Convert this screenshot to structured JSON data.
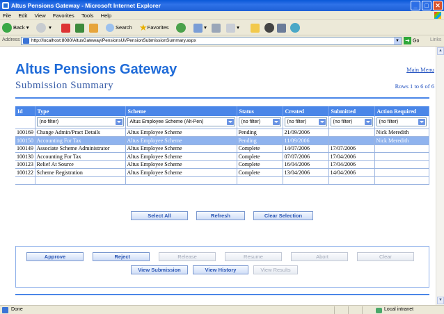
{
  "window": {
    "title": "Altus Pensions Gateway - Microsoft Internet Explorer"
  },
  "menu": [
    "File",
    "Edit",
    "View",
    "Favorites",
    "Tools",
    "Help"
  ],
  "toolbar": {
    "back": "Back",
    "search": "Search",
    "favorites": "Favorites"
  },
  "address": {
    "label": "Address",
    "url": "http://localhost:8080/AltusGateway/PensionsUI/PensionSubmissionSummary.aspx",
    "go": "Go",
    "links": "Links"
  },
  "page": {
    "title": "Altus Pensions Gateway",
    "subtitle": "Submission Summary",
    "main_menu": "Main Menu",
    "row_count": "Rows 1 to 6 of 6"
  },
  "table": {
    "headers": [
      "Id",
      "Type",
      "Scheme",
      "Status",
      "Created",
      "Submitted",
      "Action Required"
    ],
    "filters": [
      "(no filter)",
      "Altus Employee Scheme (Alt-Pen)",
      "(no filter)",
      "(no filter)",
      "(no filter)",
      "(no filter)"
    ],
    "rows": [
      [
        "100169",
        "Change Admin/Pract Details",
        "Altus Employee Scheme",
        "Pending",
        "21/09/2006",
        "",
        "Nick Meredith"
      ],
      [
        "100150",
        "Accounting For Tax",
        "Altus Employee Scheme",
        "Pending",
        "11/09/2006",
        "",
        "Nick Meredith"
      ],
      [
        "100149",
        "Associate Scheme Administrator",
        "Altus Employee Scheme",
        "Complete",
        "14/07/2006",
        "17/07/2006",
        ""
      ],
      [
        "100130",
        "Accounting For Tax",
        "Altus Employee Scheme",
        "Complete",
        "07/07/2006",
        "17/04/2006",
        ""
      ],
      [
        "100123",
        "Relief At Source",
        "Altus Employee Scheme",
        "Complete",
        "16/04/2006",
        "17/04/2006",
        ""
      ],
      [
        "100122",
        "Scheme Registration",
        "Altus Employee Scheme",
        "Complete",
        "13/04/2006",
        "14/04/2006",
        ""
      ]
    ],
    "selected_row": 1
  },
  "grid_buttons": {
    "select_all": "Select All",
    "refresh": "Refresh",
    "clear_selection": "Clear Selection"
  },
  "actions": {
    "approve": "Approve",
    "reject": "Reject",
    "release": "Release",
    "resume": "Resume",
    "abort": "Abort",
    "clear": "Clear",
    "view_submission": "View Submission",
    "view_history": "View History",
    "view_results": "View Results"
  },
  "status": {
    "left": "Done",
    "zone": "Local intranet"
  },
  "colors": {
    "accent": "#4a86e8",
    "title": "#1f6bd8",
    "selected_row": "#8fb3ee"
  }
}
